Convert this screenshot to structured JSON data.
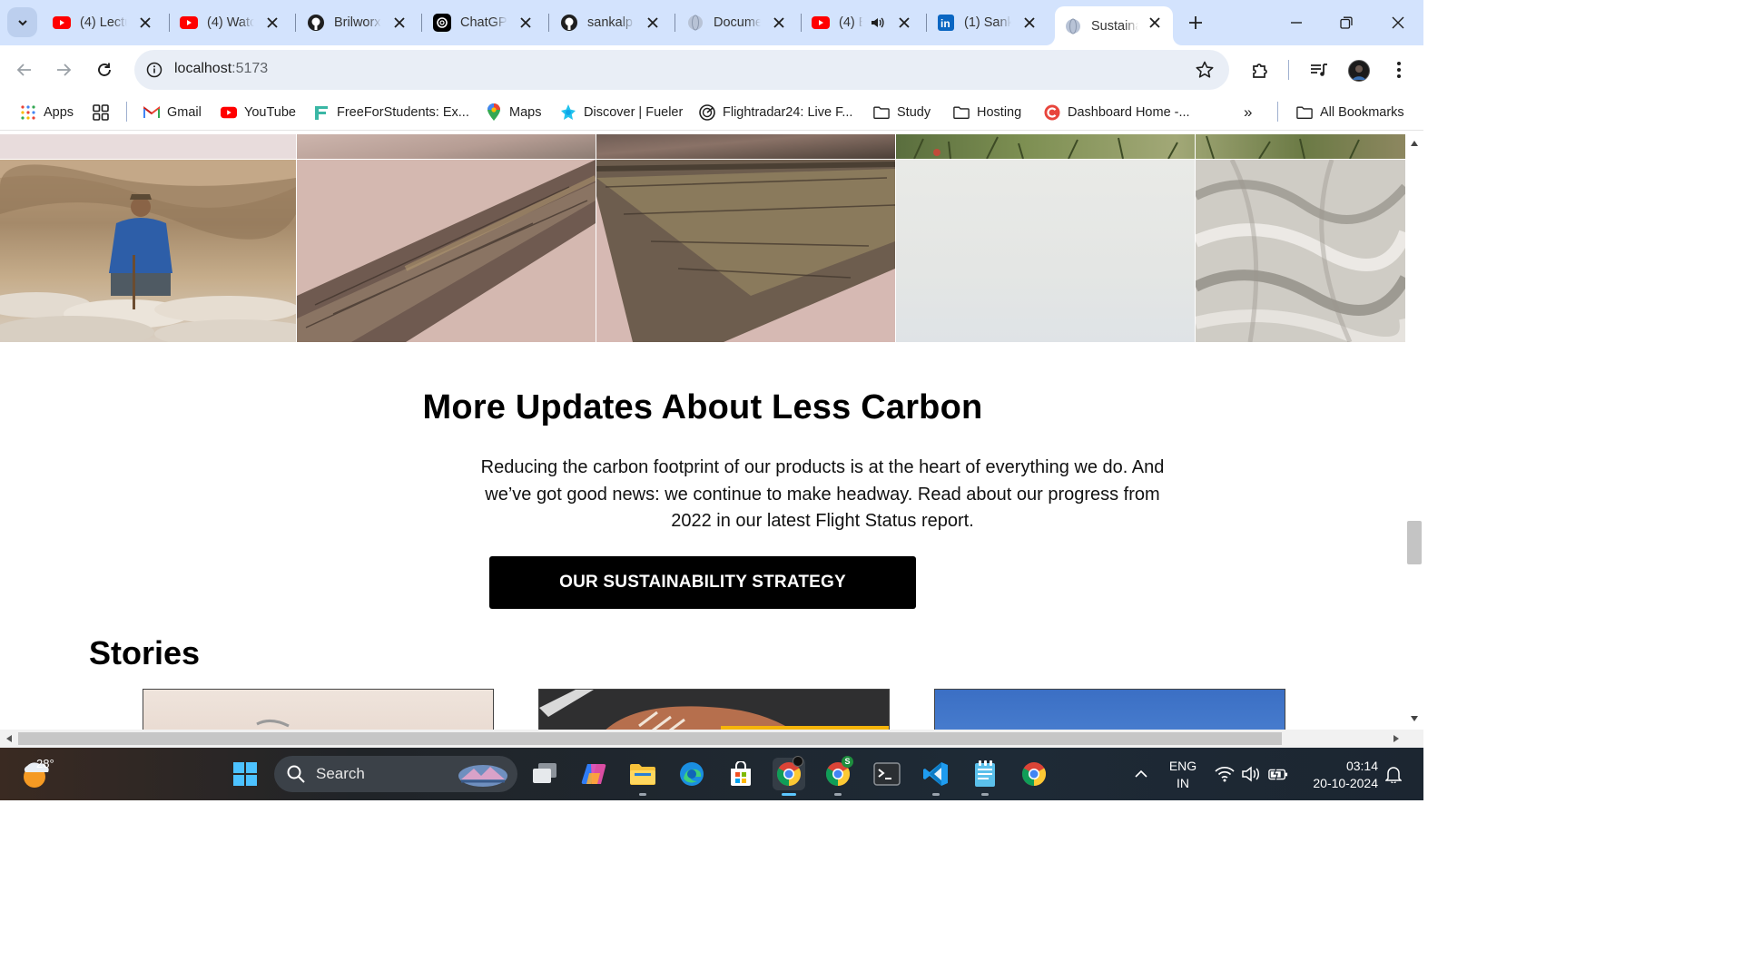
{
  "browser": {
    "tabs": [
      {
        "title": "(4) Lectu",
        "icon": "youtube-icon"
      },
      {
        "title": "(4) Watc",
        "icon": "youtube-icon"
      },
      {
        "title": "Brilworx",
        "icon": "github-icon"
      },
      {
        "title": "ChatGPT",
        "icon": "chatgpt-icon"
      },
      {
        "title": "sankalp",
        "icon": "github-icon"
      },
      {
        "title": "Docume",
        "icon": "globe-icon"
      },
      {
        "title": "(4) E",
        "icon": "youtube-icon",
        "audio": true
      },
      {
        "title": "(1) Sank",
        "icon": "linkedin-icon"
      },
      {
        "title": "Sustaina",
        "icon": "globe-icon",
        "active": true
      }
    ],
    "address": {
      "host": "localhost",
      "port": ":5173"
    },
    "bookmarks": [
      {
        "label": "Apps",
        "icon": "apps-grid-icon"
      },
      {
        "label": "Gmail",
        "icon": "gmail-icon"
      },
      {
        "label": "YouTube",
        "icon": "youtube-icon"
      },
      {
        "label": "FreeForStudents: Ex...",
        "icon": "freeforstudents-icon"
      },
      {
        "label": "Maps",
        "icon": "maps-pin-icon"
      },
      {
        "label": "Discover | Fueler",
        "icon": "fueler-icon"
      },
      {
        "label": "Flightradar24: Live F...",
        "icon": "flightradar-icon"
      },
      {
        "label": "Study",
        "icon": "folder-icon"
      },
      {
        "label": "Hosting",
        "icon": "folder-icon"
      },
      {
        "label": "Dashboard Home -...",
        "icon": "dashboard-icon"
      }
    ],
    "more_bookmarks": "»",
    "all_bookmarks": "All Bookmarks"
  },
  "page": {
    "heading": "More Updates About Less Carbon",
    "paragraph": "Reducing the carbon footprint of our products is at the heart of everything we do. And we’ve got good news: we continue to make headway. Read about our progress from 2022 in our latest Flight Status report.",
    "cta_label": "OUR SUSTAINABILITY STRATEGY",
    "stories_heading": "Stories"
  },
  "taskbar": {
    "weather_temp": "28°",
    "search_label": "Search",
    "language_line1": "ENG",
    "language_line2": "IN",
    "time": "03:14",
    "date": "20-10-2024"
  },
  "colors": {
    "tab_strip": "#d3e3fd",
    "omnibox": "#e9eef6",
    "cta_background": "#000000",
    "cta_text": "#ffffff"
  }
}
